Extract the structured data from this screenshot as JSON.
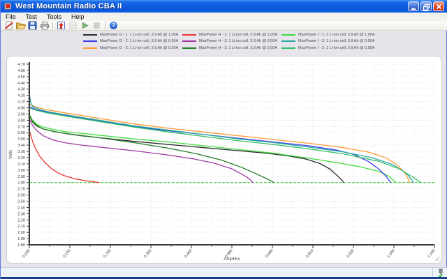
{
  "window": {
    "title": "West Mountain Radio CBA II"
  },
  "menu": {
    "items": [
      "File",
      "Test",
      "Tools",
      "Help"
    ]
  },
  "toolbar": {
    "icons": [
      "new-test-icon",
      "open-icon",
      "save-icon",
      "print-icon",
      "upload-icon",
      "preview-icon-disabled",
      "start-test-icon",
      "stop-test-icon-disabled",
      "help-icon"
    ],
    "help_glyph": "?"
  },
  "legend": {
    "items": [
      {
        "label": "MaxPower G - 1: 1 Li-ion cell, 3.9 Ah @ 1.00A",
        "color": "#2b2b2b"
      },
      {
        "label": "MaxPower G - 2: 1 Li-ion cell, 3.9 Ah @ 0.50A",
        "color": "#3b3bee"
      },
      {
        "label": "MaxPower G - 3: 1 Li-ion cell, 3.9 Ah @ 0.50A",
        "color": "#ff9933"
      },
      {
        "label": "MaxPower H - 1: 1 Li-ion cell, 3.9 Ah @ 1.00A",
        "color": "#ee3333"
      },
      {
        "label": "MaxPower H - 2: 1 Li-ion cell, 3.9 Ah @ 0.50A",
        "color": "#a038a0"
      },
      {
        "label": "MaxPower H - 3: 1 Li-ion cell, 3.9 Ah @ 0.50A",
        "color": "#227a22"
      },
      {
        "label": "MaxPower I - 1: 1 Li-ion cell, 3.9 Ah @ 1.00A",
        "color": "#3ddc3d"
      },
      {
        "label": "MaxPower I - 2: 1 Li-ion cell, 3.9 Ah @ 0.50A",
        "color": "#2aa79f"
      },
      {
        "label": "MaxPower I - 3: 1 Li-ion cell, 3.9 Ah @ 0.50A",
        "color": "#2fbf62"
      }
    ]
  },
  "chart_data": {
    "type": "line",
    "xlabel": "AmpHrs",
    "ylabel": "Volts",
    "xlim": [
      0,
      1.16
    ],
    "ylim": [
      1.8,
      4.7
    ],
    "grid": true,
    "xtick_labels": [
      "0.000",
      "0.120",
      "0.230",
      "0.350",
      "0.460",
      "0.580",
      "0.690",
      "0.810",
      "0.930",
      "1.040",
      "1.160"
    ],
    "ytick_labels": [
      "4.70",
      "4.60",
      "4.50",
      "4.40",
      "4.30",
      "4.20",
      "4.10",
      "4.00",
      "3.90",
      "3.80",
      "3.70",
      "3.60",
      "3.50",
      "3.40",
      "3.30",
      "3.20",
      "3.10",
      "3.00",
      "2.90",
      "2.80",
      "2.70",
      "2.60",
      "2.50",
      "2.40",
      "2.30",
      "2.20",
      "2.10",
      "2.00",
      "1.90",
      "1.80"
    ],
    "cutoff_line": {
      "volts": 2.8,
      "color": "#2db82d"
    },
    "series": [
      {
        "name": "MaxPower G - 1",
        "current": "1.00A",
        "color": "#2b2b2b",
        "points": [
          [
            0,
            3.88
          ],
          [
            0.008,
            3.78
          ],
          [
            0.02,
            3.71
          ],
          [
            0.04,
            3.66
          ],
          [
            0.07,
            3.62
          ],
          [
            0.1,
            3.59
          ],
          [
            0.15,
            3.55
          ],
          [
            0.2,
            3.52
          ],
          [
            0.3,
            3.46
          ],
          [
            0.4,
            3.41
          ],
          [
            0.5,
            3.36
          ],
          [
            0.6,
            3.31
          ],
          [
            0.68,
            3.27
          ],
          [
            0.74,
            3.23
          ],
          [
            0.79,
            3.18
          ],
          [
            0.83,
            3.11
          ],
          [
            0.86,
            3.02
          ],
          [
            0.88,
            2.92
          ],
          [
            0.895,
            2.84
          ],
          [
            0.9,
            2.8
          ]
        ]
      },
      {
        "name": "MaxPower H - 1",
        "current": "1.00A",
        "color": "#ee3333",
        "points": [
          [
            0,
            3.64
          ],
          [
            0.006,
            3.52
          ],
          [
            0.012,
            3.42
          ],
          [
            0.02,
            3.32
          ],
          [
            0.03,
            3.22
          ],
          [
            0.045,
            3.12
          ],
          [
            0.06,
            3.04
          ],
          [
            0.08,
            2.96
          ],
          [
            0.1,
            2.91
          ],
          [
            0.13,
            2.86
          ],
          [
            0.16,
            2.83
          ],
          [
            0.2,
            2.8
          ]
        ]
      },
      {
        "name": "MaxPower I - 1",
        "current": "1.00A",
        "color": "#3ddc3d",
        "points": [
          [
            0,
            3.9
          ],
          [
            0.008,
            3.81
          ],
          [
            0.02,
            3.74
          ],
          [
            0.04,
            3.69
          ],
          [
            0.07,
            3.65
          ],
          [
            0.1,
            3.62
          ],
          [
            0.2,
            3.56
          ],
          [
            0.3,
            3.5
          ],
          [
            0.4,
            3.45
          ],
          [
            0.5,
            3.39
          ],
          [
            0.6,
            3.33
          ],
          [
            0.7,
            3.27
          ],
          [
            0.8,
            3.19
          ],
          [
            0.88,
            3.12
          ],
          [
            0.95,
            3.05
          ],
          [
            1.0,
            2.98
          ],
          [
            1.03,
            2.9
          ],
          [
            1.05,
            2.8
          ]
        ]
      },
      {
        "name": "MaxPower G - 2",
        "current": "0.50A",
        "color": "#3b3bee",
        "points": [
          [
            0,
            4.02
          ],
          [
            0.02,
            3.97
          ],
          [
            0.05,
            3.93
          ],
          [
            0.1,
            3.88
          ],
          [
            0.2,
            3.79
          ],
          [
            0.3,
            3.7
          ],
          [
            0.4,
            3.63
          ],
          [
            0.5,
            3.57
          ],
          [
            0.6,
            3.51
          ],
          [
            0.7,
            3.45
          ],
          [
            0.8,
            3.39
          ],
          [
            0.88,
            3.32
          ],
          [
            0.93,
            3.25
          ],
          [
            0.97,
            3.14
          ],
          [
            1.0,
            3.02
          ],
          [
            1.02,
            2.91
          ],
          [
            1.035,
            2.8
          ]
        ]
      },
      {
        "name": "MaxPower G - 3",
        "current": "0.50A",
        "color": "#ff9933",
        "points": [
          [
            0,
            4.06
          ],
          [
            0.02,
            4.01
          ],
          [
            0.05,
            3.97
          ],
          [
            0.1,
            3.92
          ],
          [
            0.2,
            3.83
          ],
          [
            0.3,
            3.74
          ],
          [
            0.4,
            3.67
          ],
          [
            0.5,
            3.61
          ],
          [
            0.6,
            3.55
          ],
          [
            0.7,
            3.49
          ],
          [
            0.8,
            3.43
          ],
          [
            0.9,
            3.36
          ],
          [
            0.97,
            3.29
          ],
          [
            1.02,
            3.2
          ],
          [
            1.05,
            3.1
          ],
          [
            1.075,
            2.96
          ],
          [
            1.09,
            2.8
          ]
        ]
      },
      {
        "name": "MaxPower H - 2",
        "current": "0.50A",
        "color": "#a038a0",
        "points": [
          [
            0,
            3.82
          ],
          [
            0.008,
            3.73
          ],
          [
            0.02,
            3.64
          ],
          [
            0.04,
            3.55
          ],
          [
            0.07,
            3.48
          ],
          [
            0.1,
            3.44
          ],
          [
            0.15,
            3.4
          ],
          [
            0.2,
            3.37
          ],
          [
            0.3,
            3.31
          ],
          [
            0.4,
            3.24
          ],
          [
            0.47,
            3.18
          ],
          [
            0.53,
            3.11
          ],
          [
            0.58,
            3.02
          ],
          [
            0.61,
            2.93
          ],
          [
            0.63,
            2.86
          ],
          [
            0.64,
            2.8
          ]
        ]
      },
      {
        "name": "MaxPower H - 3",
        "current": "0.50A",
        "color": "#227a22",
        "points": [
          [
            0,
            3.87
          ],
          [
            0.008,
            3.79
          ],
          [
            0.02,
            3.72
          ],
          [
            0.04,
            3.66
          ],
          [
            0.07,
            3.62
          ],
          [
            0.1,
            3.59
          ],
          [
            0.2,
            3.52
          ],
          [
            0.3,
            3.44
          ],
          [
            0.4,
            3.35
          ],
          [
            0.48,
            3.26
          ],
          [
            0.55,
            3.16
          ],
          [
            0.61,
            3.04
          ],
          [
            0.65,
            2.94
          ],
          [
            0.68,
            2.86
          ],
          [
            0.7,
            2.8
          ]
        ]
      },
      {
        "name": "MaxPower I - 2",
        "current": "0.50A",
        "color": "#2aa79f",
        "points": [
          [
            0,
            4.22
          ],
          [
            0.004,
            4.08
          ],
          [
            0.01,
            4.02
          ],
          [
            0.03,
            3.97
          ],
          [
            0.06,
            3.93
          ],
          [
            0.1,
            3.89
          ],
          [
            0.2,
            3.8
          ],
          [
            0.3,
            3.71
          ],
          [
            0.4,
            3.64
          ],
          [
            0.5,
            3.57
          ],
          [
            0.6,
            3.5
          ],
          [
            0.7,
            3.44
          ],
          [
            0.8,
            3.37
          ],
          [
            0.9,
            3.29
          ],
          [
            0.98,
            3.2
          ],
          [
            1.04,
            3.09
          ],
          [
            1.08,
            2.95
          ],
          [
            1.1,
            2.8
          ]
        ]
      },
      {
        "name": "MaxPower I - 3",
        "current": "0.50A",
        "color": "#2fbf62",
        "points": [
          [
            0,
            4.0
          ],
          [
            0.02,
            3.96
          ],
          [
            0.05,
            3.92
          ],
          [
            0.1,
            3.87
          ],
          [
            0.2,
            3.78
          ],
          [
            0.3,
            3.69
          ],
          [
            0.4,
            3.61
          ],
          [
            0.5,
            3.54
          ],
          [
            0.6,
            3.47
          ],
          [
            0.7,
            3.41
          ],
          [
            0.8,
            3.34
          ],
          [
            0.9,
            3.26
          ],
          [
            1.0,
            3.14
          ],
          [
            1.06,
            3.02
          ],
          [
            1.1,
            2.88
          ],
          [
            1.12,
            2.8
          ]
        ]
      }
    ]
  },
  "statusbar": {
    "device_icon": "device-connected-icon"
  },
  "colors": {
    "titlebar": "#0f5bdc",
    "panel_bg": "#ffffff",
    "client_bg": "#e7e5eb",
    "grid": "#dadada",
    "axis": "#3c3c3c"
  }
}
